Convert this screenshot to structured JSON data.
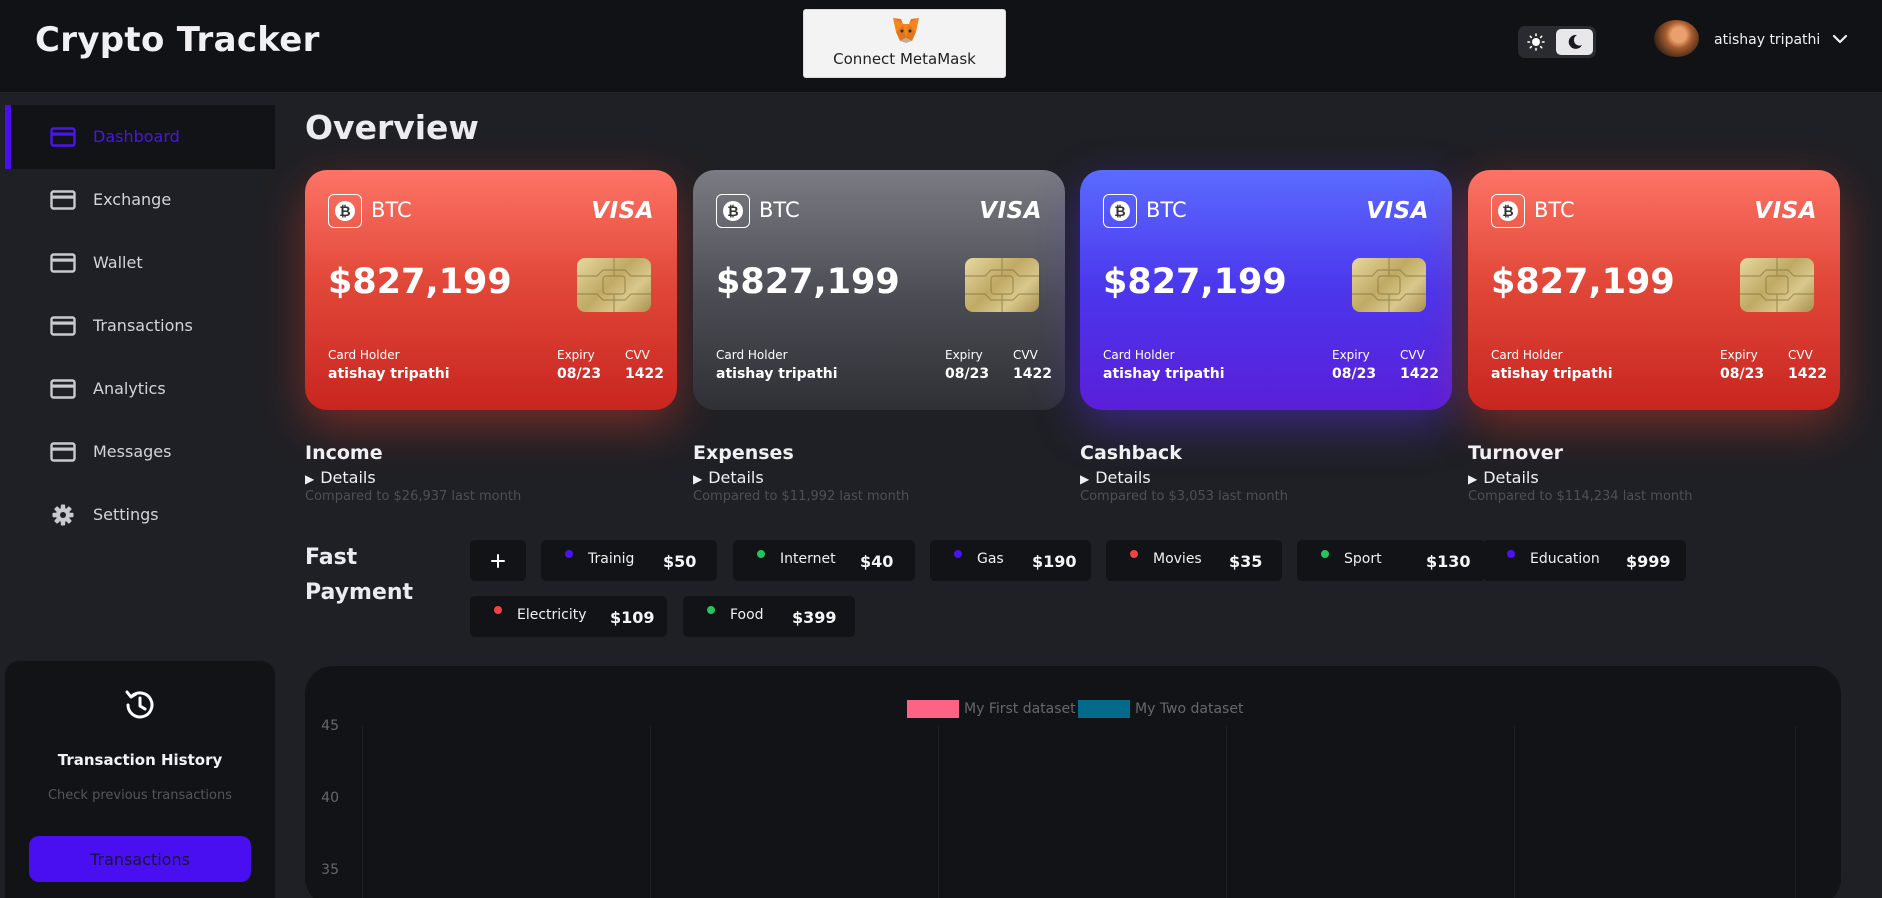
{
  "header": {
    "app_title": "Crypto Tracker",
    "connect_label": "Connect MetaMask",
    "user_name": "atishay tripathi"
  },
  "sidebar": {
    "items": [
      {
        "label": "Dashboard",
        "icon": "card-icon",
        "active": true
      },
      {
        "label": "Exchange",
        "icon": "card-icon"
      },
      {
        "label": "Wallet",
        "icon": "card-icon"
      },
      {
        "label": "Transactions",
        "icon": "card-icon"
      },
      {
        "label": "Analytics",
        "icon": "card-icon"
      },
      {
        "label": "Messages",
        "icon": "card-icon"
      },
      {
        "label": "Settings",
        "icon": "gear-icon"
      }
    ],
    "history": {
      "title": "Transaction History",
      "subtitle": "Check previous transactions",
      "button": "Transactions"
    }
  },
  "main": {
    "title": "Overview",
    "cards": [
      {
        "coin": "BTC",
        "brand": "VISA",
        "amount": "$827,199",
        "holder_label": "Card Holder",
        "holder": "atishay tripathi",
        "expiry_label": "Expiry",
        "expiry": "08/23",
        "cvv_label": "CVV",
        "cvv": "1422",
        "theme": "red"
      },
      {
        "coin": "BTC",
        "brand": "VISA",
        "amount": "$827,199",
        "holder_label": "Card Holder",
        "holder": "atishay tripathi",
        "expiry_label": "Expiry",
        "expiry": "08/23",
        "cvv_label": "CVV",
        "cvv": "1422",
        "theme": "gray"
      },
      {
        "coin": "BTC",
        "brand": "VISA",
        "amount": "$827,199",
        "holder_label": "Card Holder",
        "holder": "atishay tripathi",
        "expiry_label": "Expiry",
        "expiry": "08/23",
        "cvv_label": "CVV",
        "cvv": "1422",
        "theme": "blue"
      },
      {
        "coin": "BTC",
        "brand": "VISA",
        "amount": "$827,199",
        "holder_label": "Card Holder",
        "holder": "atishay tripathi",
        "expiry_label": "Expiry",
        "expiry": "08/23",
        "cvv_label": "CVV",
        "cvv": "1422",
        "theme": "red"
      }
    ],
    "stats": [
      {
        "name": "Income",
        "details": "Details",
        "compare": "Compared to $26,937 last month"
      },
      {
        "name": "Expenses",
        "details": "Details",
        "compare": "Compared to $11,992 last month"
      },
      {
        "name": "Cashback",
        "details": "Details",
        "compare": "Compared to $3,053 last month"
      },
      {
        "name": "Turnover",
        "details": "Details",
        "compare": "Compared to $114,234 last month"
      }
    ],
    "fast_payment": {
      "title_line1": "Fast",
      "title_line2": "Payment",
      "add_label": "+",
      "items": [
        {
          "label": "Trainig",
          "amount": "$50",
          "color": "#4a14ee"
        },
        {
          "label": "Internet",
          "amount": "$40",
          "color": "#22c55e"
        },
        {
          "label": "Gas",
          "amount": "$190",
          "color": "#4a14ee"
        },
        {
          "label": "Movies",
          "amount": "$35",
          "color": "#ef4444"
        },
        {
          "label": "Sport",
          "amount": "$130",
          "color": "#22c55e"
        },
        {
          "label": "Education",
          "amount": "$999",
          "color": "#4a14ee"
        },
        {
          "label": "Electricity",
          "amount": "$109",
          "color": "#ef4444"
        },
        {
          "label": "Food",
          "amount": "$399",
          "color": "#22c55e"
        }
      ]
    }
  },
  "chart_data": {
    "type": "bar",
    "series": [
      {
        "name": "My First dataset",
        "color": "#ff6384",
        "values": []
      },
      {
        "name": "My Two dataset",
        "color": "#036a8c",
        "values": []
      }
    ],
    "y_ticks": [
      "45",
      "40",
      "35"
    ],
    "grid": true,
    "legend": "top-center"
  },
  "colors": {
    "accent": "#4a0ff0",
    "background": "#1f2025",
    "panel": "#121317"
  }
}
